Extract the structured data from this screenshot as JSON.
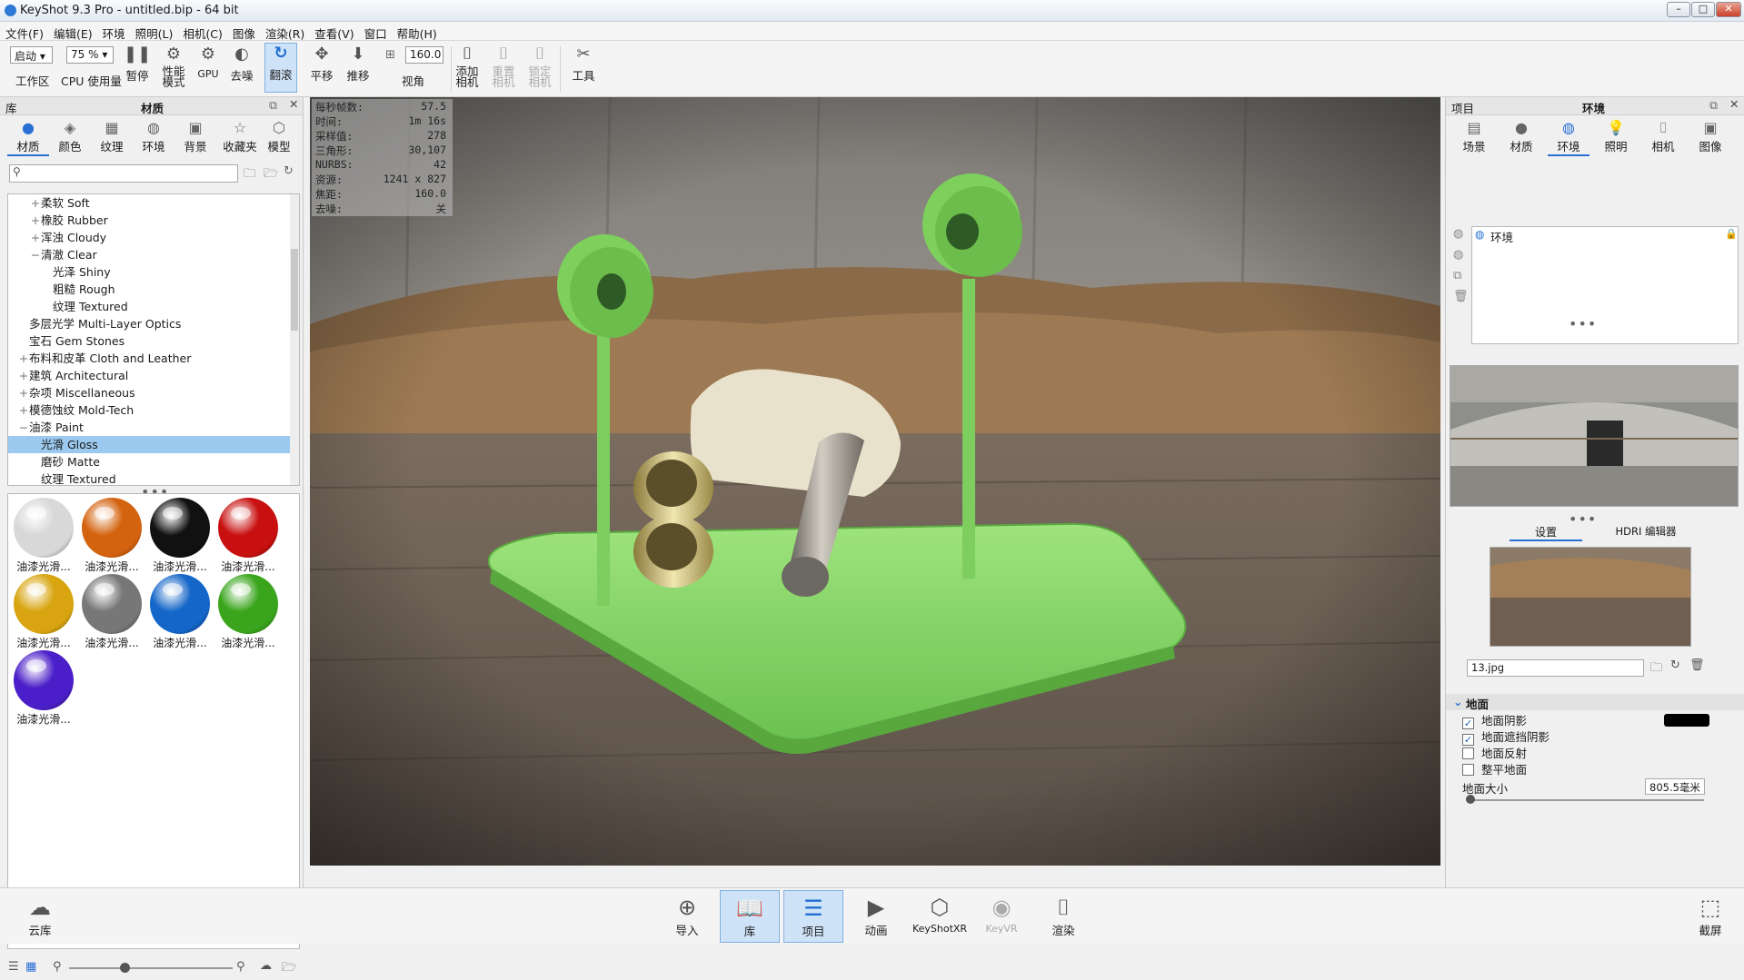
{
  "window": {
    "title": "KeyShot 9.3 Pro  -  untitled.bip  - 64 bit",
    "btn_min": "–",
    "btn_max": "□",
    "btn_close": "✕"
  },
  "menu": [
    "文件(F)",
    "编辑(E)",
    "环境",
    "照明(L)",
    "相机(C)",
    "图像",
    "渲染(R)",
    "查看(V)",
    "窗口",
    "帮助(H)"
  ],
  "toolbar": {
    "workspace_value": "启动",
    "workspace_label": "工作区",
    "cpu_value": "75 %",
    "cpu_label": "CPU 使用量",
    "pause_label": "暂停",
    "perf_label": "性能\n模式",
    "gpu_label": "GPU",
    "denoise_label": "去噪",
    "tumble_label": "翻滚",
    "pan_label": "平移",
    "dolly_label": "推移",
    "fov_value": "160.0",
    "fov_label": "视角",
    "add_camera_label": "添加\n相机",
    "reset_camera_label": "重置\n相机",
    "lock_camera_label": "锁定\n相机",
    "tools_label": "工具"
  },
  "left": {
    "header_left": "库",
    "header_title": "材质",
    "tabs": [
      "材质",
      "颜色",
      "纹理",
      "环境",
      "背景",
      "收藏夹",
      "模型"
    ],
    "tree": [
      {
        "pm": "+",
        "indent": 2,
        "text": "柔软 Soft"
      },
      {
        "pm": "+",
        "indent": 2,
        "text": "橡胶 Rubber"
      },
      {
        "pm": "+",
        "indent": 2,
        "text": "浑浊 Cloudy"
      },
      {
        "pm": "−",
        "indent": 2,
        "text": "清澈 Clear"
      },
      {
        "pm": "",
        "indent": 3,
        "text": "光泽 Shiny"
      },
      {
        "pm": "",
        "indent": 3,
        "text": "粗糙 Rough"
      },
      {
        "pm": "",
        "indent": 3,
        "text": "纹理 Textured"
      },
      {
        "pm": "",
        "indent": 1,
        "text": "多层光学 Multi-Layer Optics"
      },
      {
        "pm": "",
        "indent": 1,
        "text": "宝石 Gem Stones"
      },
      {
        "pm": "+",
        "indent": 1,
        "text": "布料和皮革 Cloth and Leather"
      },
      {
        "pm": "+",
        "indent": 1,
        "text": "建筑 Architectural"
      },
      {
        "pm": "+",
        "indent": 1,
        "text": "杂项 Miscellaneous"
      },
      {
        "pm": "+",
        "indent": 1,
        "text": "模德蚀纹 Mold-Tech"
      },
      {
        "pm": "−",
        "indent": 1,
        "text": "油漆 Paint"
      },
      {
        "pm": "",
        "indent": 2,
        "text": "光滑 Gloss",
        "selected": true
      },
      {
        "pm": "",
        "indent": 2,
        "text": "磨砂 Matte"
      },
      {
        "pm": "",
        "indent": 2,
        "text": "纹理 Textured"
      }
    ],
    "materials": [
      {
        "label": "油漆光滑...",
        "color": "#d8d8d8"
      },
      {
        "label": "油漆光滑...",
        "color": "#d4630f"
      },
      {
        "label": "油漆光滑...",
        "color": "#111111"
      },
      {
        "label": "油漆光滑...",
        "color": "#c81010"
      },
      {
        "label": "油漆光滑...",
        "color": "#d8a510"
      },
      {
        "label": "油漆光滑...",
        "color": "#777777"
      },
      {
        "label": "油漆光滑...",
        "color": "#1466c8"
      },
      {
        "label": "油漆光滑...",
        "color": "#3aa51c"
      },
      {
        "label": "油漆光滑...",
        "color": "#4a1ec8"
      }
    ]
  },
  "stats": [
    {
      "k": "每秒帧数:",
      "v": "57.5"
    },
    {
      "k": "时间:",
      "v": "1m 16s"
    },
    {
      "k": "采样值:",
      "v": "278"
    },
    {
      "k": "三角形:",
      "v": "30,107"
    },
    {
      "k": "NURBS:",
      "v": "42"
    },
    {
      "k": "资源:",
      "v": "1241 x 827"
    },
    {
      "k": "焦距:",
      "v": "160.0"
    },
    {
      "k": "去噪:",
      "v": "关"
    }
  ],
  "right": {
    "header_left": "项目",
    "header_title": "环境",
    "tabs": [
      "场景",
      "材质",
      "环境",
      "照明",
      "相机",
      "图像"
    ],
    "env_item": "环境",
    "subtabs": [
      "设置",
      "HDRI 编辑器"
    ],
    "file": "13.jpg",
    "ground_title": "地面",
    "ground": [
      {
        "label": "地面阴影",
        "checked": true
      },
      {
        "label": "地面遮挡阴影",
        "checked": true
      },
      {
        "label": "地面反射",
        "checked": false
      },
      {
        "label": "整平地面",
        "checked": false
      }
    ],
    "ground_size_label": "地面大小",
    "ground_size_value": "805.5毫米",
    "shadow_color": "#000000"
  },
  "bottom": {
    "cloud": "云库",
    "import": "导入",
    "library": "库",
    "project": "项目",
    "animation": "动画",
    "keyshotxr": "KeyShotXR",
    "keyvr": "KeyVR",
    "render": "渲染",
    "screenshot": "截屏"
  }
}
